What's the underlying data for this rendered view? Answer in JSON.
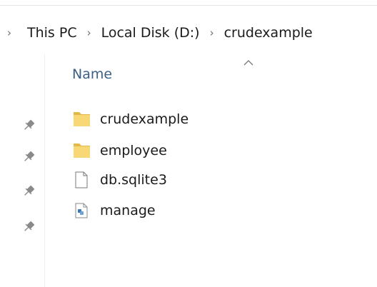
{
  "breadcrumb": {
    "items": [
      {
        "label": "This PC"
      },
      {
        "label": "Local Disk (D:)"
      },
      {
        "label": "crudexample"
      }
    ]
  },
  "columns": {
    "name_label": "Name",
    "sort": "ascending"
  },
  "files": [
    {
      "name": "crudexample",
      "type": "folder",
      "icon": "folder-icon"
    },
    {
      "name": "employee",
      "type": "folder",
      "icon": "folder-icon"
    },
    {
      "name": "db.sqlite3",
      "type": "file",
      "icon": "file-icon"
    },
    {
      "name": "manage",
      "type": "python-file",
      "icon": "python-file-icon"
    }
  ],
  "quick_access_pins": 4,
  "colors": {
    "folder": "#f8d775",
    "folder_dark": "#e2b84a",
    "header_text": "#3c5f87"
  }
}
